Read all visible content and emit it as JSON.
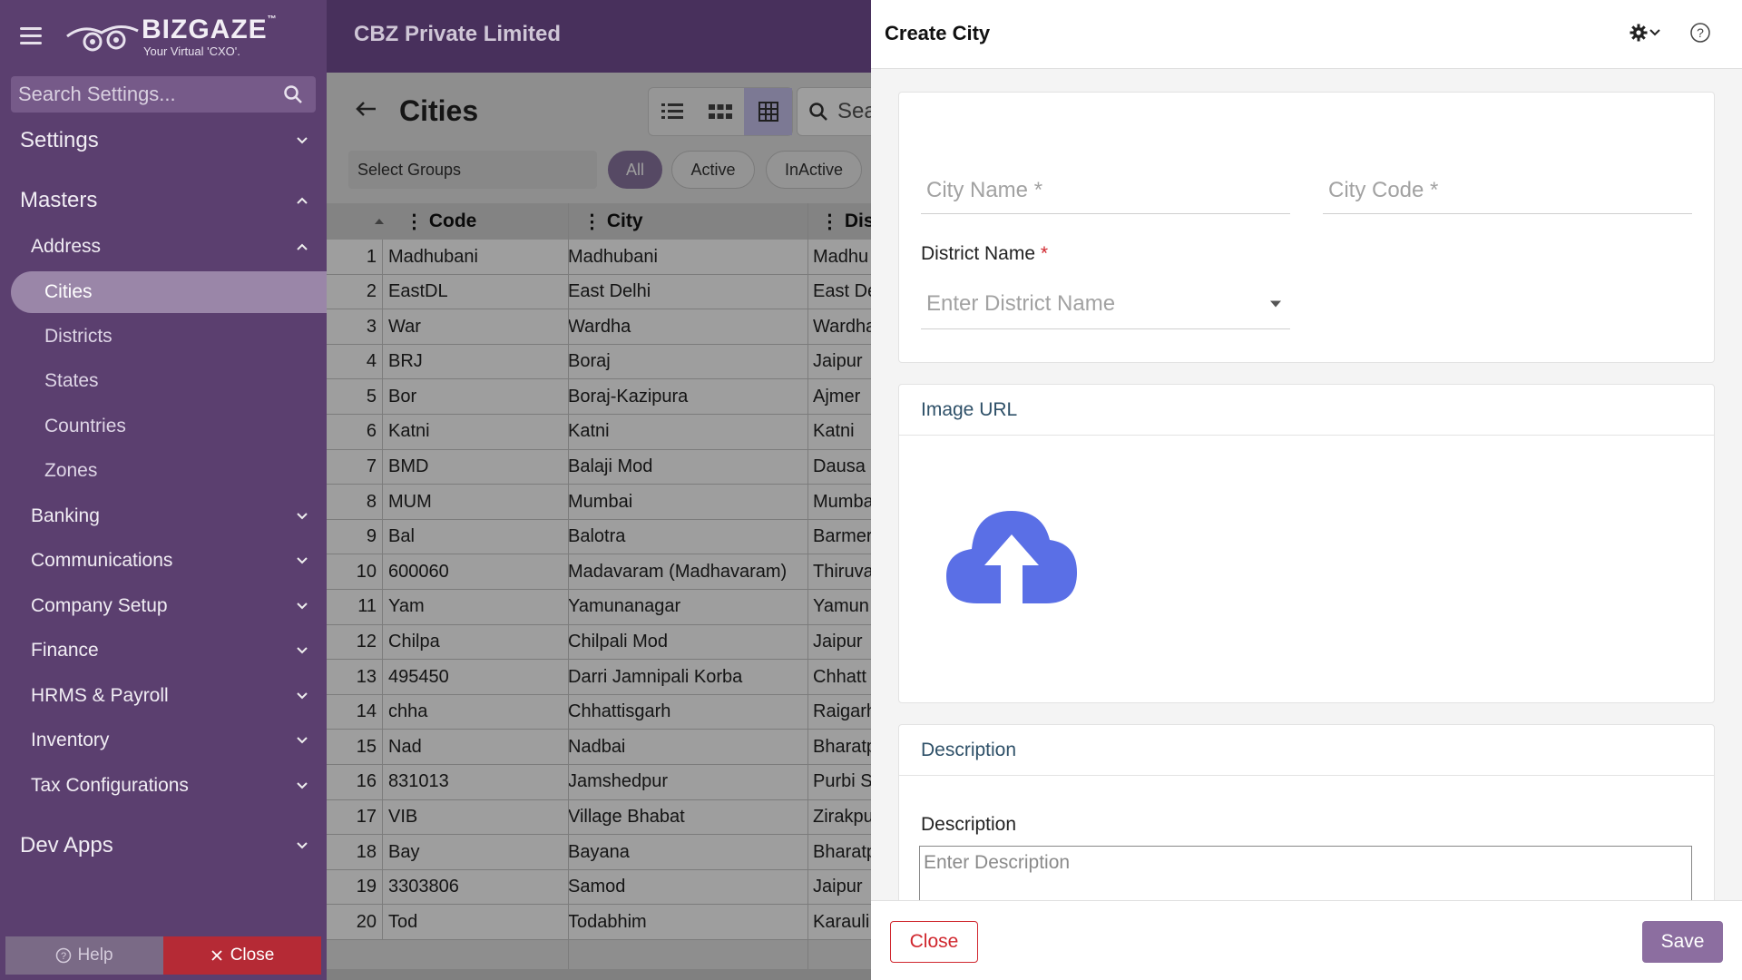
{
  "sidebar": {
    "logo_name": "BIZGAZE",
    "logo_tm": "™",
    "logo_tagline": "Your Virtual 'CXO'.",
    "search_placeholder": "Search Settings...",
    "settings_label": "Settings",
    "masters_label": "Masters",
    "address_label": "Address",
    "address_items": [
      "Cities",
      "Districts",
      "States",
      "Countries",
      "Zones"
    ],
    "groups": [
      "Banking",
      "Communications",
      "Company Setup",
      "Finance",
      "HRMS & Payroll",
      "Inventory",
      "Tax Configurations"
    ],
    "dev_apps_label": "Dev Apps",
    "help_label": "Help",
    "close_label": "Close"
  },
  "header": {
    "company": "CBZ Private Limited"
  },
  "list": {
    "title": "Cities",
    "search_text": "Sea",
    "group_select": "Select Groups",
    "filters": [
      "All",
      "Active",
      "InActive"
    ],
    "columns": [
      "Code",
      "City",
      "Dist"
    ],
    "rows": [
      {
        "n": "1",
        "code": "Madhubani",
        "city": "Madhubani",
        "dist": "Madhu"
      },
      {
        "n": "2",
        "code": "EastDL",
        "city": "East Delhi",
        "dist": "East De"
      },
      {
        "n": "3",
        "code": "War",
        "city": "Wardha",
        "dist": "Wardha"
      },
      {
        "n": "4",
        "code": "BRJ",
        "city": "Boraj",
        "dist": "Jaipur"
      },
      {
        "n": "5",
        "code": "Bor",
        "city": "Boraj-Kazipura",
        "dist": "Ajmer"
      },
      {
        "n": "6",
        "code": "Katni",
        "city": "Katni",
        "dist": "Katni"
      },
      {
        "n": "7",
        "code": "BMD",
        "city": "Balaji Mod",
        "dist": "Dausa"
      },
      {
        "n": "8",
        "code": "MUM",
        "city": "Mumbai",
        "dist": "Mumba"
      },
      {
        "n": "9",
        "code": "Bal",
        "city": "Balotra",
        "dist": "Barmer"
      },
      {
        "n": "10",
        "code": "600060",
        "city": "Madavaram (Madhavaram)",
        "dist": "Thiruva"
      },
      {
        "n": "11",
        "code": "Yam",
        "city": "Yamunanagar",
        "dist": "Yamun"
      },
      {
        "n": "12",
        "code": "Chilpa",
        "city": "Chilpali Mod",
        "dist": "Jaipur"
      },
      {
        "n": "13",
        "code": "495450",
        "city": "Darri Jamnipali Korba",
        "dist": "Chhatt"
      },
      {
        "n": "14",
        "code": "chha",
        "city": "Chhattisgarh",
        "dist": "Raigarh"
      },
      {
        "n": "15",
        "code": "Nad",
        "city": "Nadbai",
        "dist": "Bharatp"
      },
      {
        "n": "16",
        "code": "831013",
        "city": "Jamshedpur",
        "dist": "Purbi S"
      },
      {
        "n": "17",
        "code": "VIB",
        "city": "Village Bhabat",
        "dist": "Zirakpu"
      },
      {
        "n": "18",
        "code": "Bay",
        "city": "Bayana",
        "dist": "Bharatp"
      },
      {
        "n": "19",
        "code": "3303806",
        "city": "Samod",
        "dist": "Jaipur"
      },
      {
        "n": "20",
        "code": "Tod",
        "city": "Todabhim",
        "dist": "Karauli"
      }
    ]
  },
  "drawer": {
    "title": "Create City",
    "city_name_placeholder": "City Name *",
    "city_code_placeholder": "City Code *",
    "district_label": "District Name",
    "required_mark": "*",
    "district_placeholder": "Enter District Name",
    "image_section": "Image URL",
    "description_section": "Description",
    "description_label": "Description",
    "description_placeholder": "Enter Description",
    "close_label": "Close",
    "save_label": "Save"
  },
  "colors": {
    "sidebar_bg": "#5b3f6f",
    "accent": "#8c6ea0",
    "upload_icon": "#5a6fe6",
    "danger": "#d0272e"
  },
  "icons": [
    "menu-icon",
    "logo-owl-icon",
    "search-icon",
    "chevron-down-icon",
    "chevron-up-icon",
    "back-arrow-icon",
    "list-view-icon",
    "card-view-icon",
    "grid-view-icon",
    "gear-icon",
    "help-icon",
    "cloud-upload-icon",
    "close-icon"
  ]
}
